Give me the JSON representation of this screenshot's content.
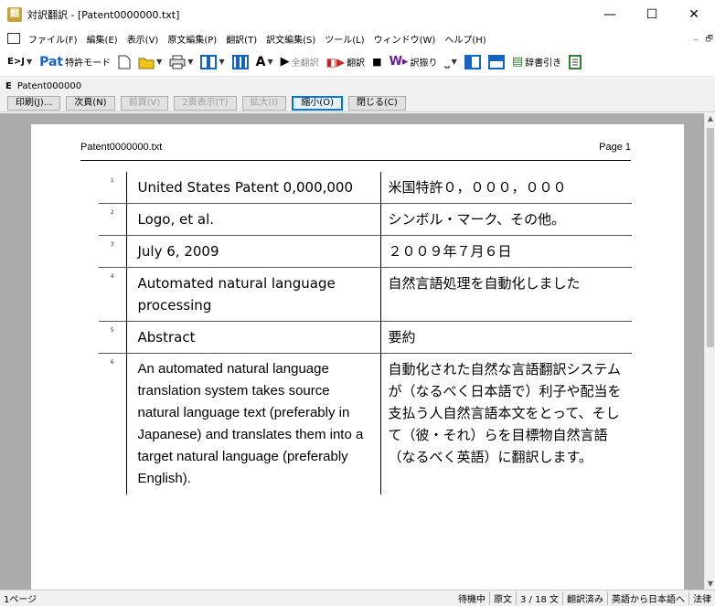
{
  "window": {
    "title": "対訳翻訳 - [Patent0000000.txt]",
    "minimize": "—",
    "maximize": "☐",
    "close": "✕",
    "app_icon": "翻"
  },
  "menu": {
    "items": [
      "ファイル(F)",
      "編集(E)",
      "表示(V)",
      "原文編集(P)",
      "翻訳(T)",
      "訳文編集(S)",
      "ツール(L)",
      "ウィンドウ(W)",
      "ヘルプ(H)"
    ],
    "mdi_min": "_",
    "mdi_restore": "🗗"
  },
  "toolbar": {
    "ej_label": "E>J",
    "pat_label": "Pat",
    "patent_mode": "特許モード",
    "translate_all": "全翻訳",
    "translate": "翻訳",
    "assign": "訳振り",
    "dictionary": "辞書引き",
    "font_label": "A"
  },
  "doc": {
    "e_marker": "E",
    "name": "Patent000000"
  },
  "preview_buttons": [
    {
      "label": "印刷(J)...",
      "state": "normal"
    },
    {
      "label": "次頁(N)",
      "state": "normal"
    },
    {
      "label": "前頁(V)",
      "state": "disabled"
    },
    {
      "label": "2頁表示(T)",
      "state": "disabled"
    },
    {
      "label": "拡大(I)",
      "state": "disabled"
    },
    {
      "label": "縮小(O)",
      "state": "active"
    },
    {
      "label": "閉じる(C)",
      "state": "normal"
    }
  ],
  "page": {
    "filename": "Patent0000000.txt",
    "page_label": "Page 1",
    "rows": [
      {
        "num": "1",
        "src": "United States Patent 0,000,000",
        "dst": "米国特許０，０００，０００"
      },
      {
        "num": "2",
        "src": "Logo, et al.",
        "dst": "シンボル・マーク、その他。"
      },
      {
        "num": "3",
        "src": "July 6, 2009",
        "dst": "２００９年７月６日"
      },
      {
        "num": "4",
        "src": "Automated natural language processing",
        "dst": "自然言語処理を自動化しました"
      },
      {
        "num": "5",
        "src": "Abstract",
        "dst": "要約"
      },
      {
        "num": "6",
        "src": "An automated natural language translation system takes source natural language text (preferably in Japanese) and translates them into a target natural language (preferably English).",
        "dst": "自動化された自然な言語翻訳システムが（なるべく日本語で）利子や配当を支払う人自然言語本文をとって、そして（彼・それ）らを目標物自然言語（なるべく英語）に翻訳します。"
      }
    ]
  },
  "status": {
    "pages": "1ページ",
    "state": "待機中",
    "source": "原文",
    "sentence": "3 / 18 文",
    "translated": "翻訳済み",
    "direction": "英語から日本語へ",
    "field": "法律"
  }
}
